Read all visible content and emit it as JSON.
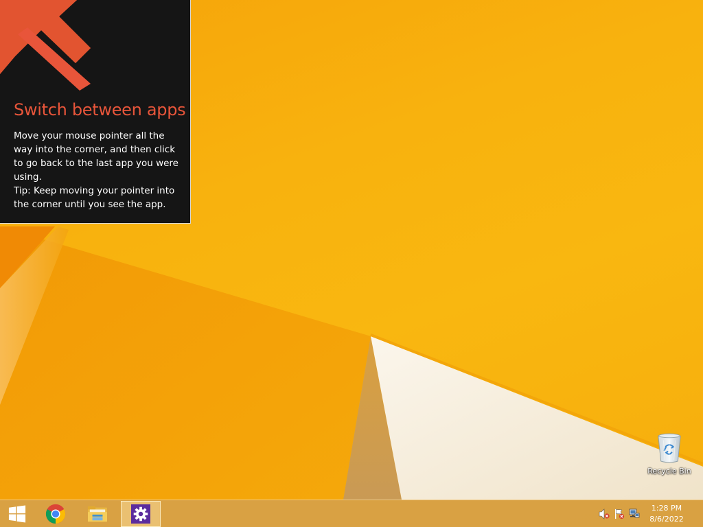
{
  "tip": {
    "title": "Switch between apps",
    "body_line1": "Move your mouse pointer all the way into the corner, and then click to go back to the last app you were using.",
    "body_line2": "Tip: Keep moving your pointer into the corner until you see the app.",
    "accent_color": "#e8553a",
    "background_color": "#151515"
  },
  "desktop": {
    "wallpaper_colors": [
      "#f6a40a",
      "#f9b710",
      "#f0e4d0"
    ],
    "icons": [
      {
        "label": "Recycle Bin",
        "icon": "recycle-bin-icon"
      }
    ]
  },
  "taskbar": {
    "pinned": [
      {
        "name": "Start",
        "icon": "windows-logo-icon"
      },
      {
        "name": "Google Chrome",
        "icon": "chrome-icon"
      },
      {
        "name": "File Explorer",
        "icon": "folder-icon"
      },
      {
        "name": "Settings",
        "icon": "gear-icon",
        "active": true
      }
    ],
    "tray": {
      "icons": [
        "speaker-muted-icon",
        "action-center-flag-icon",
        "network-icon"
      ],
      "time": "1:28 PM",
      "date": "8/6/2022"
    }
  }
}
